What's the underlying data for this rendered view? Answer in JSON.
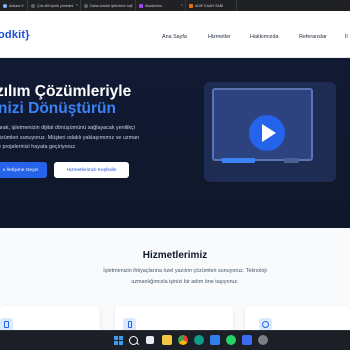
{
  "browser": {
    "tabs": [
      {
        "title": "Ankara VDS Sunucu"
      },
      {
        "title": "Çok dilli içerik yönetimi"
      },
      {
        "title": "Daha önceki işlemlerin kaybol"
      },
      {
        "title": "Akademim"
      },
      {
        "title": "ADIF KAAN SABİ"
      }
    ]
  },
  "site": {
    "logo": "odkit}",
    "nav": {
      "home": "Ana Sayfa",
      "services": "Hizmetler",
      "about": "Hakkımızda",
      "references": "Referanslar",
      "contact": "İl"
    },
    "hero": {
      "title_line1": "zılım Çözümleriyle",
      "title_line2": "nizi Dönüştürün",
      "desc_line1": "arak, işletmenizin dijital dönüşümünü sağlayacak yenilikçi",
      "desc_line2": "özümleri sunuyoruz. Müşteri odaklı yaklaşımımız ve uzman",
      "desc_line3": "e projelerinizi hayata geçiriyoruz.",
      "primary_button": "e İletişime Geçin",
      "secondary_button": "Hizmetlerimizi Keşfedin"
    },
    "services": {
      "heading": "Hizmetlerimiz",
      "description": "İşletmenizin ihtiyaçlarına özel yazılım çözümleri sunuyoruz. Teknoloji uzmanlığımızla işinizi bir adım öne taşıyoruz."
    }
  },
  "colors": {
    "accent": "#2563eb",
    "hero_bg": "#0f172a",
    "highlight": "#3b82f6"
  },
  "taskbar": {
    "items": [
      "windows-start-icon",
      "search-icon",
      "task-view-icon",
      "file-explorer-icon",
      "chrome-icon",
      "edge-icon",
      "vscode-icon",
      "whatsapp-icon",
      "store-icon",
      "settings-icon"
    ]
  }
}
